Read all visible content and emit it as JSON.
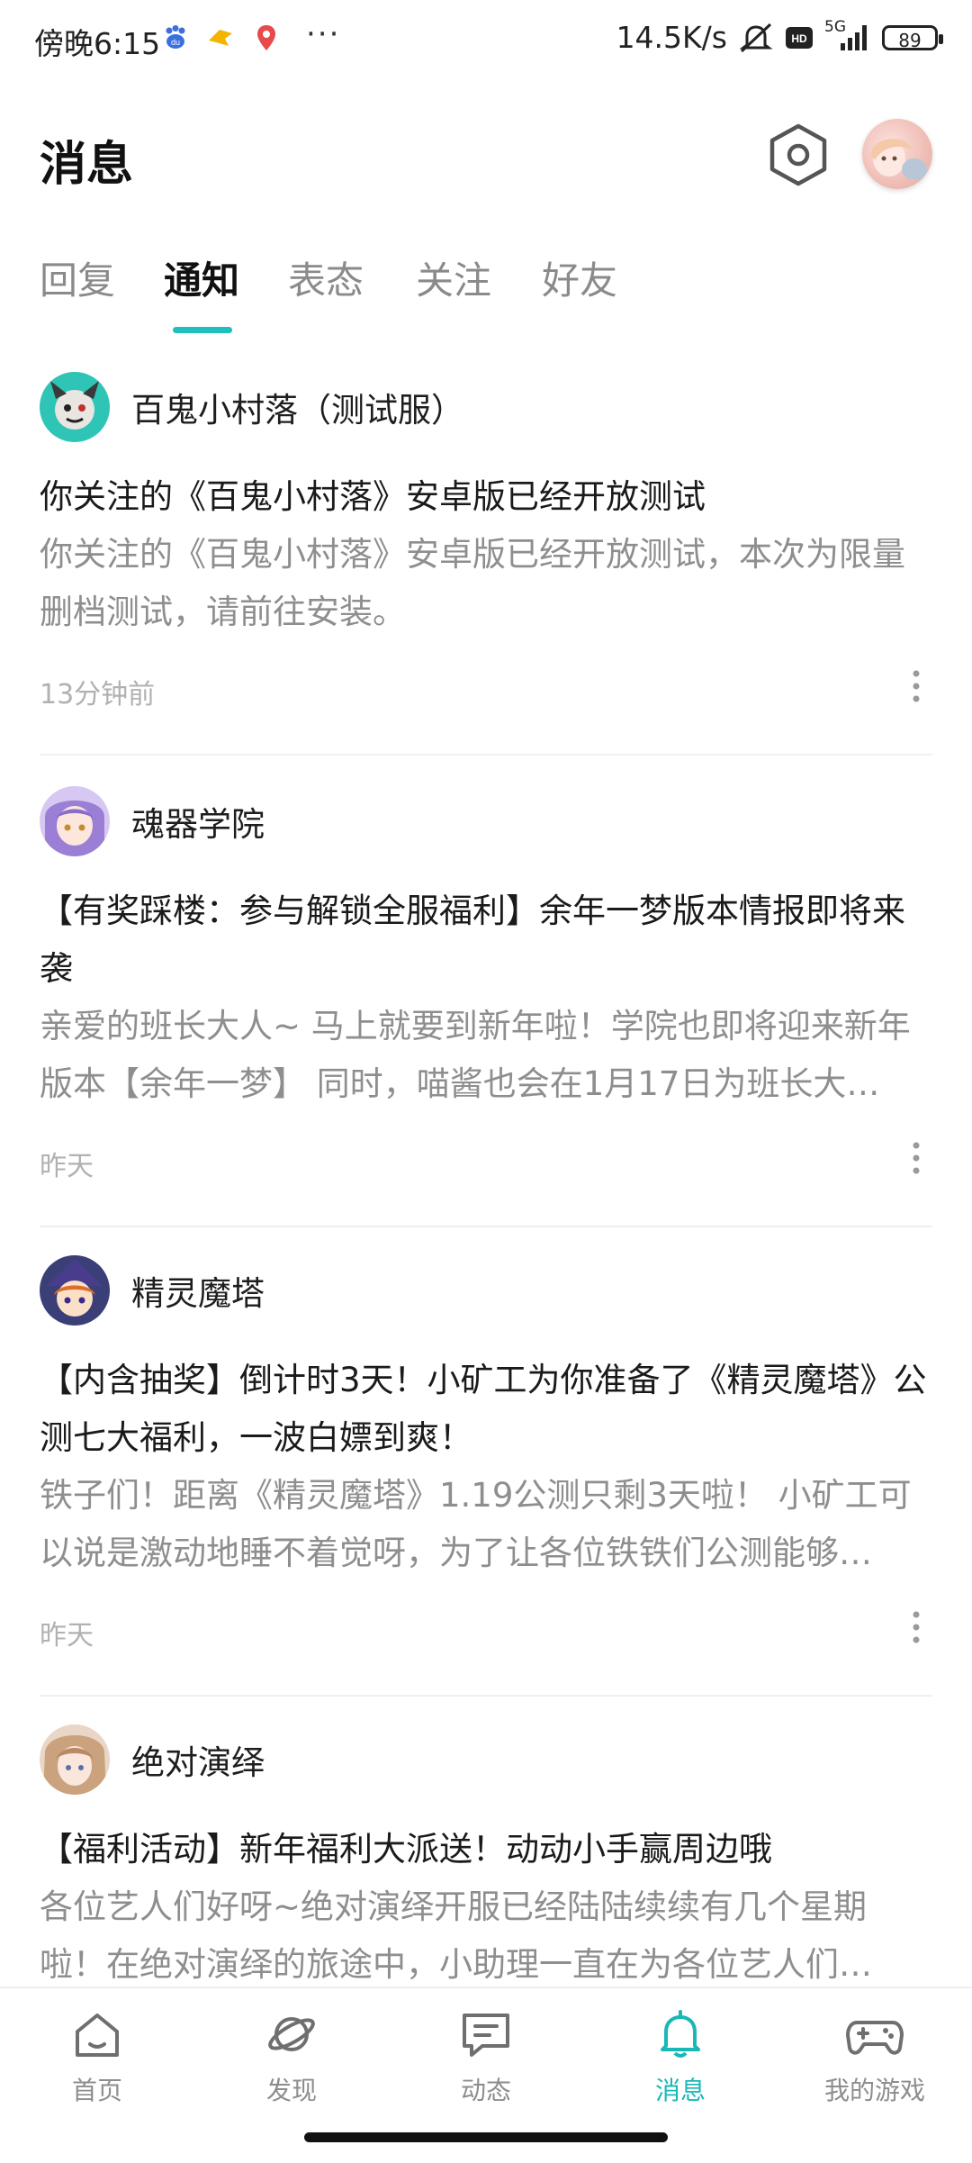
{
  "status_bar": {
    "time": "傍晚6:15",
    "dots": "···",
    "speed": "14.5K/s",
    "network": "5G",
    "battery": "89",
    "icons": [
      "baidu-icon",
      "bird-app-icon",
      "map-pin-icon",
      "mute-icon",
      "hd-icon",
      "signal-icon",
      "battery-icon"
    ]
  },
  "header": {
    "title": "消息",
    "settings_icon": "hexagon-settings-icon",
    "avatar": "user-avatar"
  },
  "tabs": [
    {
      "label": "回复",
      "active": false
    },
    {
      "label": "通知",
      "active": true
    },
    {
      "label": "表态",
      "active": false
    },
    {
      "label": "关注",
      "active": false
    },
    {
      "label": "好友",
      "active": false
    }
  ],
  "accent_color": "#1fbfbe",
  "notifications": [
    {
      "sender": "百鬼小村落（测试服）",
      "title": "你关注的《百鬼小村落》安卓版已经开放测试",
      "excerpt": "你关注的《百鬼小村落》安卓版已经开放测试，本次为限量删档测试，请前往安装。",
      "time": "13分钟前"
    },
    {
      "sender": "魂器学院",
      "title": "【有奖踩楼：参与解锁全服福利】余年一梦版本情报即将来袭",
      "excerpt": "亲爱的班长大人~ 马上就要到新年啦！学院也即将迎来新年版本【余年一梦】 同时，喵酱也会在1月17日为班长大…",
      "time": "昨天"
    },
    {
      "sender": "精灵魔塔",
      "title": "【内含抽奖】倒计时3天！小矿工为你准备了《精灵魔塔》公测七大福利，一波白嫖到爽！",
      "excerpt": "铁子们！距离《精灵魔塔》1.19公测只剩3天啦！ 小矿工可以说是激动地睡不着觉呀，为了让各位铁铁们公测能够…",
      "time": "昨天"
    },
    {
      "sender": "绝对演绎",
      "title": "【福利活动】新年福利大派送！动动小手赢周边哦",
      "excerpt": "各位艺人们好呀~绝对演绎开服已经陆陆续续有几个星期啦！在绝对演绎的旅途中，小助理一直在为各位艺人们…",
      "time": ""
    }
  ],
  "bottom_nav": [
    {
      "label": "首页",
      "icon": "home-icon",
      "active": false
    },
    {
      "label": "发现",
      "icon": "discover-planet-icon",
      "active": false
    },
    {
      "label": "动态",
      "icon": "feed-chat-icon",
      "active": false
    },
    {
      "label": "消息",
      "icon": "bell-icon",
      "active": true
    },
    {
      "label": "我的游戏",
      "icon": "gamepad-icon",
      "active": false
    }
  ]
}
